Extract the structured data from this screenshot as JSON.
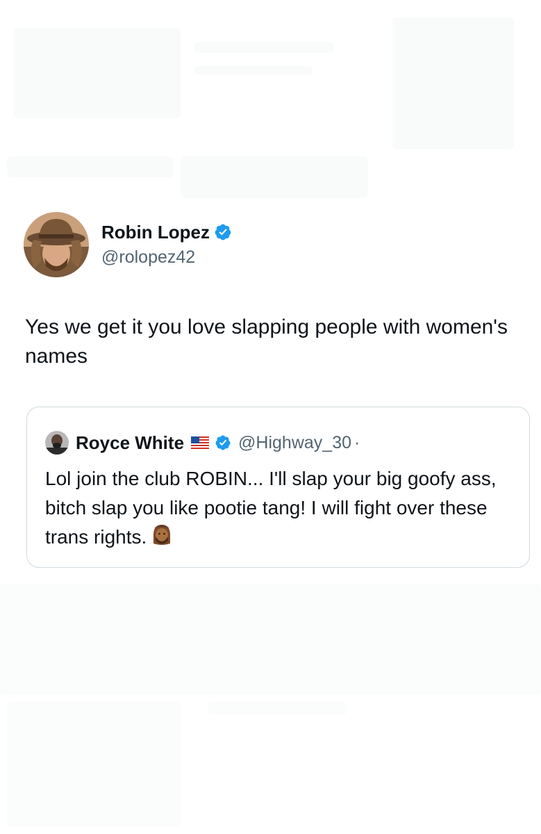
{
  "tweet": {
    "author": {
      "display_name": "Robin Lopez",
      "handle": "@rolopez42",
      "verified": true,
      "avatar_icon": "profile-photo-hat"
    },
    "text": "Yes we get it you love slapping people with women's names"
  },
  "quote": {
    "author": {
      "display_name": "Royce White",
      "flag_icon": "us-flag-icon",
      "verified": true,
      "handle": "@Highway_30",
      "separator": "·"
    },
    "text": "Lol join the club ROBIN... I'll slap your big goofy ass, bitch slap you like pootie tang! I will fight over these trans rights.",
    "emoji_icon": "bearded-person-icon"
  },
  "colors": {
    "verified_blue": "#1d9bf0",
    "text_primary": "#0f1419",
    "text_secondary": "#536471",
    "border": "#cfd9de"
  }
}
